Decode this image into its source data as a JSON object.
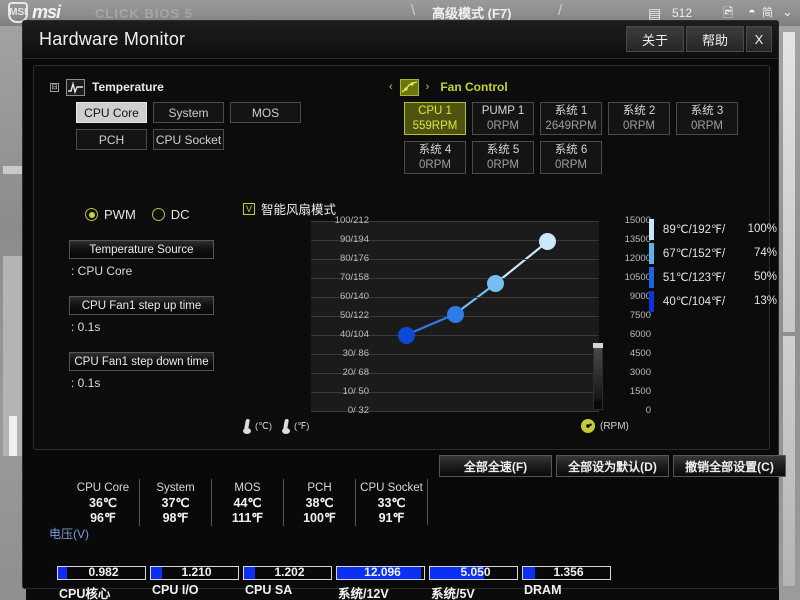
{
  "bios": {
    "brand": "msi",
    "brand_sub": "CLICK BIOS 5",
    "mode_label": "高级模式 (F7)",
    "icon_text_1": "512",
    "icon_text_2": "简"
  },
  "dialog": {
    "title": "Hardware Monitor",
    "buttons": {
      "about": "关于",
      "help": "帮助",
      "close": "X"
    }
  },
  "temperature_panel": {
    "header": "Temperature",
    "sources": [
      {
        "label": "CPU Core",
        "selected": true
      },
      {
        "label": "System",
        "selected": false
      },
      {
        "label": "MOS",
        "selected": false
      },
      {
        "label": "PCH",
        "selected": false
      },
      {
        "label": "CPU Socket",
        "selected": false
      }
    ]
  },
  "fan_panel": {
    "header": "Fan Control",
    "fans": [
      {
        "name": "CPU 1",
        "rpm": "559RPM",
        "selected": true
      },
      {
        "name": "PUMP 1",
        "rpm": "0RPM",
        "selected": false
      },
      {
        "name": "系统 1",
        "rpm": "2649RPM",
        "selected": false
      },
      {
        "name": "系统 2",
        "rpm": "0RPM",
        "selected": false
      },
      {
        "name": "系统 3",
        "rpm": "0RPM",
        "selected": false
      },
      {
        "name": "系统 4",
        "rpm": "0RPM",
        "selected": false
      },
      {
        "name": "系统 5",
        "rpm": "0RPM",
        "selected": false
      },
      {
        "name": "系统 6",
        "rpm": "0RPM",
        "selected": false
      }
    ]
  },
  "controls": {
    "mode_pwm": "PWM",
    "mode_dc": "DC",
    "selected_mode": "PWM",
    "temp_source_button": "Temperature Source",
    "temp_source_value": ": CPU Core",
    "step_up_button": "CPU Fan1 step up time",
    "step_up_value": ": 0.1s",
    "step_down_button": "CPU Fan1 step down time",
    "step_down_value": ": 0.1s"
  },
  "chart_data": {
    "type": "line",
    "title": "智能风扇模式",
    "smart_fan_checked": true,
    "xlabel": "",
    "ylabel": "",
    "y_left_unit_c": "(℃)",
    "y_left_unit_f": "(℉)",
    "y_right_unit": "(RPM)",
    "y_left_ticks": [
      "100/212",
      "90/194",
      "80/176",
      "70/158",
      "60/140",
      "50/122",
      "40/104",
      "30/ 86",
      "20/ 68",
      "10/ 50",
      "0/ 32"
    ],
    "y_right_ticks": [
      "15000",
      "13500",
      "12000",
      "10500",
      "9000",
      "7500",
      "6000",
      "4500",
      "3000",
      "1500",
      "0"
    ],
    "ylim_c": [
      0,
      100
    ],
    "ylim_rpm": [
      0,
      15000
    ],
    "points": [
      {
        "temp_c": 40,
        "temp_f": 104,
        "duty_pct": 13,
        "color": "#0b49d6"
      },
      {
        "temp_c": 51,
        "temp_f": 123,
        "duty_pct": 50,
        "color": "#2f7ce8"
      },
      {
        "temp_c": 67,
        "temp_f": 152,
        "duty_pct": 74,
        "color": "#74bef2"
      },
      {
        "temp_c": 89,
        "temp_f": 192,
        "duty_pct": 100,
        "color": "#c9e8fa"
      }
    ],
    "legend_position": "right",
    "legend": [
      {
        "temp": "89℃/192℉/",
        "pct": "100%",
        "color": "#c9e8fa"
      },
      {
        "temp": "67℃/152℉/",
        "pct": "74%",
        "color": "#5bb2ee"
      },
      {
        "temp": "51℃/123℉/",
        "pct": "50%",
        "color": "#1f63e2"
      },
      {
        "temp": "40℃/104℉/",
        "pct": "13%",
        "color": "#0b35d8"
      }
    ]
  },
  "actions": [
    {
      "label": "全部全速(F)"
    },
    {
      "label": "全部设为默认(D)"
    },
    {
      "label": "撤销全部设置(C)"
    }
  ],
  "readings": [
    {
      "name": "CPU Core",
      "c": "36℃",
      "f": "96℉"
    },
    {
      "name": "System",
      "c": "37℃",
      "f": "98℉"
    },
    {
      "name": "MOS",
      "c": "44℃",
      "f": "111℉"
    },
    {
      "name": "PCH",
      "c": "38℃",
      "f": "100℉"
    },
    {
      "name": "CPU Socket",
      "c": "33℃",
      "f": "91℉"
    }
  ],
  "voltage": {
    "title": "电压(V)",
    "items": [
      {
        "label": "CPU核心",
        "value": "0.982",
        "fill_pct": 10
      },
      {
        "label": "CPU I/O",
        "value": "1.210",
        "fill_pct": 13
      },
      {
        "label": "CPU SA",
        "value": "1.202",
        "fill_pct": 13
      },
      {
        "label": "系统/12V",
        "value": "12.096",
        "fill_pct": 96
      },
      {
        "label": "系统/5V",
        "value": "5.050",
        "fill_pct": 62
      },
      {
        "label": "DRAM",
        "value": "1.356",
        "fill_pct": 14
      }
    ]
  }
}
